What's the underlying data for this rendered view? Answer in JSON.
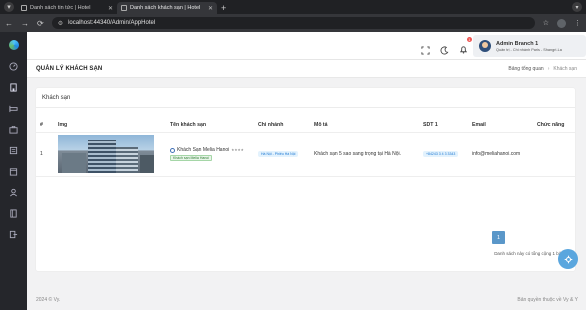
{
  "browser": {
    "tabs": [
      {
        "title": "Danh sách tin tức | Hotel",
        "active": false
      },
      {
        "title": "Danh sách khách sạn | Hotel",
        "active": true
      }
    ],
    "url": "localhost:44340/Admin/AppHotel"
  },
  "header": {
    "notification_count": "1",
    "user": {
      "name": "Admin Branch 1",
      "role": "Quản trị - Chi nhánh Paris - Shangri-La"
    }
  },
  "page": {
    "title": "QUẢN LÝ KHÁCH SẠN",
    "breadcrumb": {
      "home": "Bảng tổng quan",
      "sep": "›",
      "current": "Khách sạn"
    }
  },
  "card": {
    "title": "Khách sạn",
    "columns": [
      "#",
      "Img",
      "Tên khách sạn",
      "Chi nhánh",
      "Mô tả",
      "SDT 1",
      "Email",
      "Chức năng"
    ],
    "rows": [
      {
        "index": "1",
        "name": "Khách Sạn Melia Hanoi",
        "stars": "★★★★",
        "name_tag": "Khách sạn Melia Hanoi",
        "branch": "Hà Nội - Phiêu Hà Nội",
        "description": "Khách sạn 5 sao sang trọng tại Hà Nội.",
        "phone": "+84243 3 4 3 3343",
        "email": "info@meliahanoi.com",
        "actions": ""
      }
    ],
    "pagination": {
      "current_page": "1"
    },
    "summary": "Danh sách này có tổng cộng 1 bản ghi"
  },
  "footer": {
    "left": "2024 © Vy.",
    "right": "Bản quyền thuộc về Vy & Y"
  },
  "colors": {
    "accent": "#5a97c9",
    "sidebar": "#25262b",
    "fab": "#5aa6de"
  }
}
